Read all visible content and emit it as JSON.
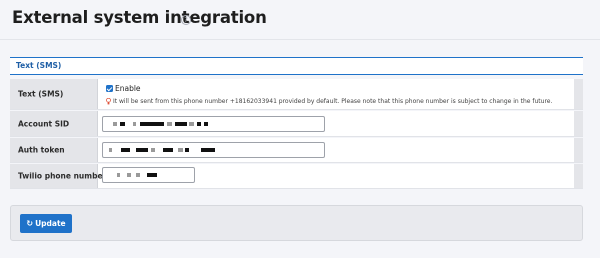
{
  "page": {
    "title": "External system integration",
    "help_icon": "question-circle-icon"
  },
  "section": {
    "title": "Text (SMS)",
    "rows": {
      "sms": {
        "label": "Text (SMS)",
        "enable_label": "Enable",
        "enabled": true,
        "note": "It will be sent from this phone number +18162033941 provided by default. Please note that this phone number is subject to change in the future.",
        "note_icon": "lightbulb-icon"
      },
      "account_sid": {
        "label": "Account SID",
        "value_masked": true
      },
      "auth_token": {
        "label": "Auth token",
        "value_masked": true
      },
      "phone_number": {
        "label": "Twilio phone number",
        "value_masked": true
      }
    }
  },
  "footer": {
    "update_label": "Update",
    "update_icon": "refresh-icon"
  },
  "colors": {
    "accent": "#1f72c9",
    "label_bg": "#e4e5e9",
    "page_bg": "#f4f5f9"
  }
}
